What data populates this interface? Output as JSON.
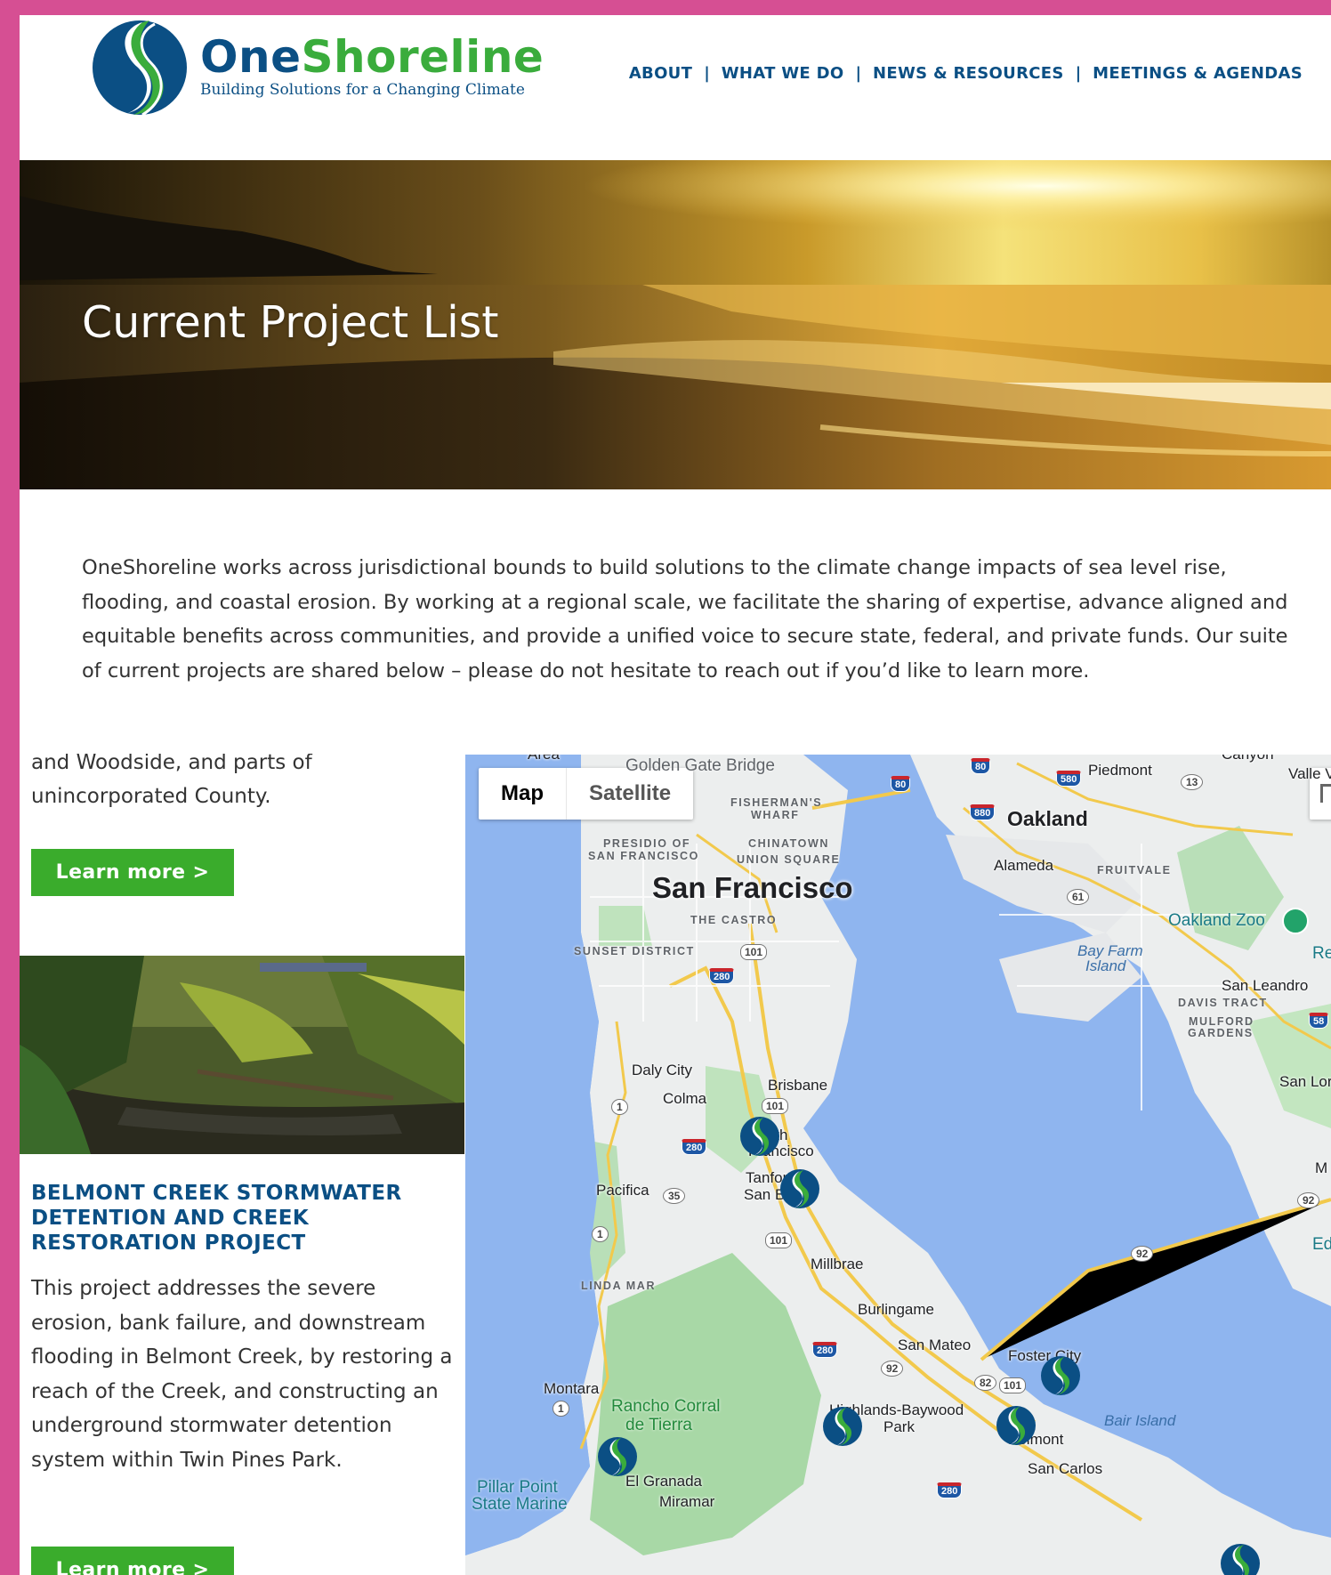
{
  "brand": {
    "name_part1": "One",
    "name_part2": "Shoreline",
    "tagline": "Building Solutions for a Changing Climate",
    "colors": {
      "navy": "#0b4f84",
      "green": "#3aac3c",
      "frame": "#d64f93"
    }
  },
  "nav": {
    "items": [
      {
        "label": "ABOUT"
      },
      {
        "label": "WHAT WE DO"
      },
      {
        "label": "NEWS & RESOURCES"
      },
      {
        "label": "MEETINGS & AGENDAS"
      }
    ],
    "separator": "|"
  },
  "hero": {
    "title": "Current Project List"
  },
  "intro": {
    "text": "OneShoreline works across jurisdictional bounds to build solutions to the climate change impacts of sea level rise, flooding, and coastal erosion. By working at a regional scale, we facilitate the sharing of expertise, advance aligned and equitable benefits across communities, and provide a unified voice to secure state, federal, and private funds. Our suite of current projects are shared below – please do not hesitate to reach out if you’d like to learn more."
  },
  "projects": {
    "previous": {
      "desc_tail": "and Woodside, and parts of unincorporated County.",
      "button": "Learn more >"
    },
    "belmont": {
      "title": "BELMONT CREEK STORMWATER DETENTION AND CREEK RESTORATION PROJECT",
      "description": "This project addresses the severe erosion, bank failure, and downstream flooding in Belmont Creek, by restoring a reach of the Creek, and constructing an underground stormwater detention system within Twin Pines Park.",
      "button": "Learn more >"
    }
  },
  "map": {
    "type_control": {
      "map": "Map",
      "satellite": "Satellite",
      "selected": "Map"
    },
    "labels": {
      "golden_gate": "Golden Gate Bridge",
      "area": "Area",
      "fishermans": "FISHERMAN'S",
      "wharf": "WHARF",
      "presidio": "PRESIDIO OF",
      "presidio2": "SAN FRANCISCO",
      "chinatown": "CHINATOWN",
      "union_square": "UNION SQUARE",
      "sf": "San Francisco",
      "castro": "THE CASTRO",
      "sunset": "SUNSET DISTRICT",
      "oakland": "Oakland",
      "piedmont": "Piedmont",
      "canyon": "Canyon",
      "valle": "Valle V",
      "alameda": "Alameda",
      "fruitvale": "FRUITVALE",
      "oakland_zoo": "Oakland Zoo",
      "re": "Re",
      "bay_farm": "Bay Farm",
      "island": "Island",
      "san_leandro": "San Leandro",
      "davis_tract": "DAVIS TRACT",
      "mulford": "MULFORD",
      "gardens": "GARDENS",
      "san_lo": "San Lor",
      "m": "M",
      "ed": "Ed",
      "daly_city": "Daly City",
      "colma": "Colma",
      "brisbane": "Brisbane",
      "south_sf1": "South",
      "south_sf2": "Francisco",
      "tanforan": "Tanforan",
      "san_bruno": "San Bruno",
      "pacifica": "Pacifica",
      "millbrae": "Millbrae",
      "linda_mar": "LINDA MAR",
      "burlingame": "Burlingame",
      "san_mateo": "San Mateo",
      "foster_city": "Foster City",
      "montara": "Montara",
      "rancho1": "Rancho Corral",
      "rancho2": "de Tierra",
      "highlands": "Highlands-Baywood",
      "park": "Park",
      "belmont": "Belmont",
      "bair": "Bair Island",
      "san_carlos": "San Carlos",
      "el_granada": "El Granada",
      "pillar1": "Pillar Point",
      "pillar2": "State Marine",
      "miramar": "Miramar"
    },
    "shields": {
      "i80a": "80",
      "i80b": "80",
      "i580": "580",
      "i880": "880",
      "i280a": "280",
      "i280b": "280",
      "i280c": "280",
      "i280d": "280",
      "us101a": "101",
      "us101b": "101",
      "us101c": "101",
      "us101d": "101",
      "ca1a": "1",
      "ca1b": "1",
      "ca1c": "1",
      "ca13": "13",
      "ca61": "61",
      "ca35": "35",
      "ca92a": "92",
      "ca92b": "92",
      "ca92c": "92",
      "ca82": "82",
      "ca58": "58"
    }
  }
}
